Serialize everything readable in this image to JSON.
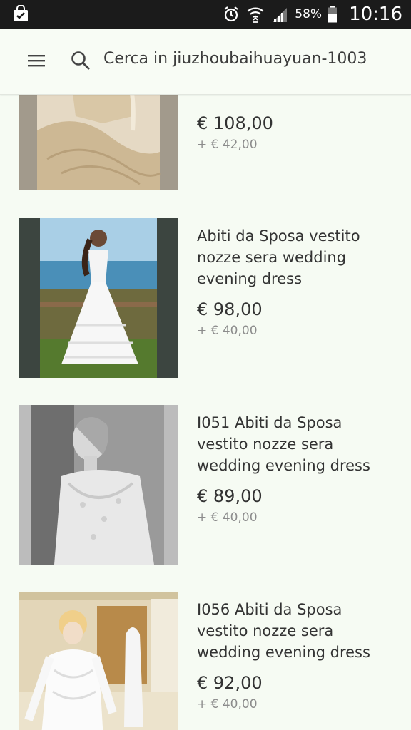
{
  "status_bar": {
    "notification_icon": "shopping-bag-check-icon",
    "alarm_icon": "alarm-icon",
    "wifi_icon": "wifi-icon",
    "signal_icon": "signal-icon",
    "battery_icon": "battery-icon",
    "battery_percent": "58%",
    "time": "10:16"
  },
  "header": {
    "menu_icon": "hamburger-menu-icon",
    "search_icon": "search-icon",
    "search_placeholder": "Cerca in jiuzhoubaihuayuan-1003"
  },
  "products": [
    {
      "title": "",
      "price": "€ 108,00",
      "shipping": "+ € 42,00",
      "image": "dress-photo-beige"
    },
    {
      "title": "Abiti da Sposa vestito nozze sera wedding evening dress",
      "price": "€ 98,00",
      "shipping": "+ € 40,00",
      "image": "dress-photo-beach"
    },
    {
      "title": "I051  Abiti da Sposa vestito nozze sera wedding evening dress",
      "price": "€ 89,00",
      "shipping": "+ € 40,00",
      "image": "dress-photo-bw"
    },
    {
      "title": "I056  Abiti da Sposa vestito nozze sera wedding evening dress",
      "price": "€ 92,00",
      "shipping": "+ € 40,00",
      "image": "dress-photo-lace"
    }
  ],
  "colors": {
    "status_bar": "#1b1b1b",
    "background": "#f6fbf3"
  }
}
